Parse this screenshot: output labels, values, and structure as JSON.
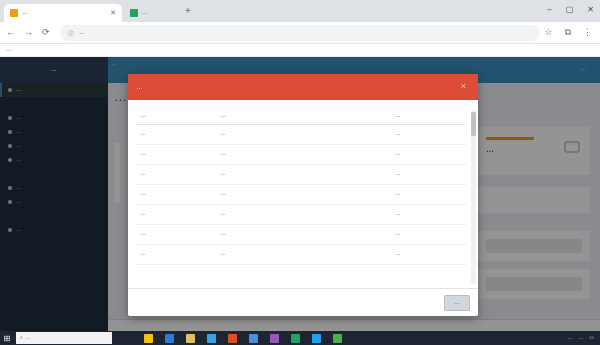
{
  "browser": {
    "tabs": [
      {
        "title": "…",
        "favicon_color": "#f29f05",
        "active": true
      },
      {
        "title": "…",
        "favicon_color": "#1fa463",
        "active": false
      }
    ],
    "new_tab_symbol": "+",
    "window_buttons": [
      "–",
      "▢",
      "✕"
    ],
    "url": "…",
    "bookmarks_label": "…"
  },
  "sidebar": {
    "brand": "…",
    "items": [
      {
        "label": "…",
        "active": true
      },
      {
        "label": "…",
        "type": "header"
      },
      {
        "label": "…"
      },
      {
        "label": "…"
      },
      {
        "label": "…"
      },
      {
        "label": "…"
      },
      {
        "label": "…",
        "type": "header"
      },
      {
        "label": "…"
      },
      {
        "label": "…"
      },
      {
        "label": "…",
        "type": "header"
      },
      {
        "label": "…"
      }
    ]
  },
  "topnav": {
    "breadcrumb": "…",
    "user": "…"
  },
  "content": {
    "page_title": "…",
    "infobox_value": "…"
  },
  "modal": {
    "title": "…",
    "close_symbol": "×",
    "columns": [
      "…",
      "…",
      "…"
    ],
    "rows": [
      [
        "…",
        "…",
        "…"
      ],
      [
        "…",
        "…",
        "…"
      ],
      [
        "…",
        "…",
        "…"
      ],
      [
        "…",
        "…",
        "…"
      ],
      [
        "…",
        "…",
        "…"
      ],
      [
        "…",
        "…",
        "…"
      ],
      [
        "…",
        "…",
        "…"
      ]
    ],
    "close_button": "…"
  },
  "taskbar": {
    "search_placeholder": "…",
    "tray_text": "…",
    "clock": "…"
  },
  "colors": {
    "modal_header": "#dd4b39",
    "sidebar_bg": "#1f2d3d",
    "topnav_bg": "#3c8dbc",
    "taskbar_bg": "#1c2531"
  }
}
